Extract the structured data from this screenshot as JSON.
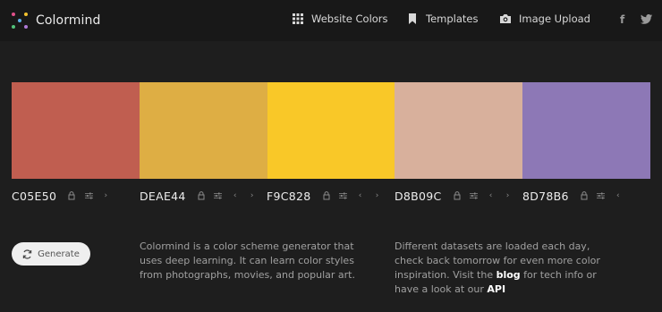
{
  "brand": {
    "name": "Colormind"
  },
  "nav": [
    {
      "label": "Website Colors",
      "icon": "grid-icon"
    },
    {
      "label": "Templates",
      "icon": "bookmark-icon"
    },
    {
      "label": "Image Upload",
      "icon": "camera-icon"
    }
  ],
  "social": {
    "facebook": "f",
    "twitter": "t"
  },
  "palette": [
    {
      "hex": "C05E50",
      "color": "#C05E50"
    },
    {
      "hex": "DEAE44",
      "color": "#DEAE44"
    },
    {
      "hex": "F9C828",
      "color": "#F9C828"
    },
    {
      "hex": "D8B09C",
      "color": "#D8B09C"
    },
    {
      "hex": "8D78B6",
      "color": "#8D78B6"
    }
  ],
  "generate": {
    "label": "Generate"
  },
  "about": {
    "text": "Colormind is a color scheme generator that uses deep learning. It can learn color styles from photographs, movies, and popular art."
  },
  "info": {
    "text_before": "Different datasets are loaded each day, check back tomorrow for even more color inspiration. Visit the ",
    "blog_link": "blog",
    "text_middle": " for tech info or have a look at our ",
    "api_link": "API"
  }
}
